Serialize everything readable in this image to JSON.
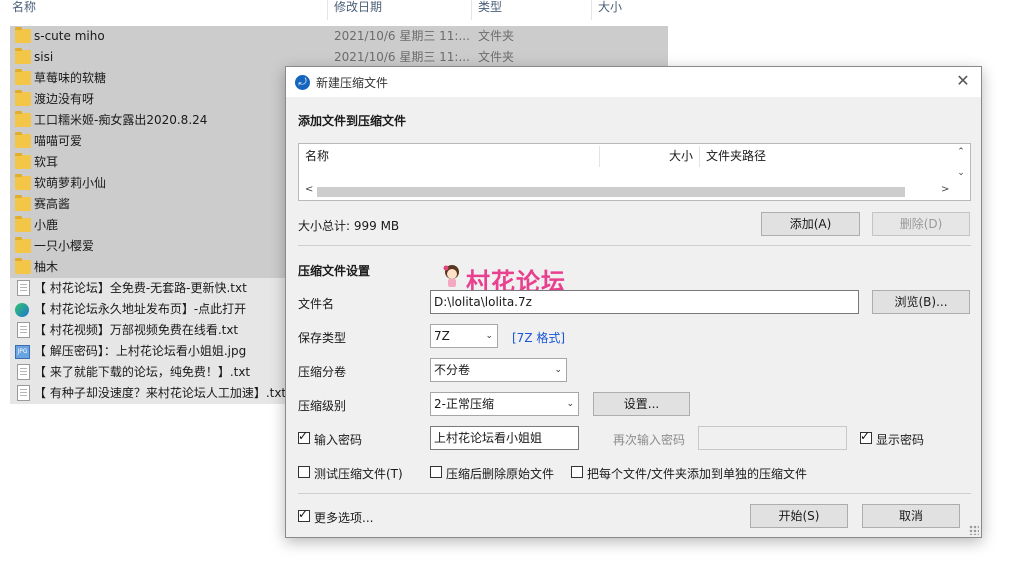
{
  "explorer": {
    "columns": {
      "name": "名称",
      "date": "修改日期",
      "type": "类型",
      "size": "大小"
    },
    "rows": [
      {
        "name": "s-cute miho",
        "date": "2021/10/6 星期三 11:...",
        "type": "文件夹",
        "icon": "folder-icon"
      },
      {
        "name": "sisi",
        "date": "2021/10/6 星期三 11:...",
        "type": "文件夹",
        "icon": "folder-icon"
      },
      {
        "name": "草莓味的软糖",
        "icon": "folder-icon"
      },
      {
        "name": "渡边没有呀",
        "icon": "folder-icon"
      },
      {
        "name": "工口糯米姬-痴女露出2020.8.24",
        "icon": "folder-icon"
      },
      {
        "name": "喵喵可爱",
        "icon": "folder-icon"
      },
      {
        "name": "软耳",
        "icon": "folder-icon"
      },
      {
        "name": "软萌萝莉小仙",
        "icon": "folder-icon"
      },
      {
        "name": "赛高酱",
        "icon": "folder-icon"
      },
      {
        "name": "小鹿",
        "icon": "folder-icon"
      },
      {
        "name": "一只小樱爱",
        "icon": "folder-icon"
      },
      {
        "name": "柚木",
        "icon": "folder-icon"
      },
      {
        "name": "【 村花论坛】全免费-无套路-更新快.txt",
        "icon": "text-file-icon"
      },
      {
        "name": "【 村花论坛永久地址发布页】-点此打开",
        "icon": "edge-browser-icon"
      },
      {
        "name": "【 村花视频】万部视频免费在线看.txt",
        "icon": "text-file-icon"
      },
      {
        "name": "【 解压密码】：上村花论坛看小姐姐.jpg",
        "icon": "image-file-icon"
      },
      {
        "name": "【 来了就能下载的论坛，纯免费！】.txt",
        "icon": "text-file-icon"
      },
      {
        "name": "【 有种子却没速度？来村花论坛人工加速】.txt",
        "icon": "text-file-icon"
      }
    ]
  },
  "dialog": {
    "title": "新建压缩文件",
    "add_section_title": "添加文件到压缩文件",
    "list_headers": {
      "name": "名称",
      "size": "大小",
      "path": "文件夹路径"
    },
    "total_size": "大小总计: 999 MB",
    "add_button": "添加(A)",
    "delete_button": "删除(D)",
    "settings_title": "压缩文件设置",
    "filename_label": "文件名",
    "filename_value": "D:\\lolita\\lolita.7z",
    "browse_button": "浏览(B)...",
    "save_type_label": "保存类型",
    "save_type_value": "7Z",
    "format_link": "[7Z 格式]",
    "split_label": "压缩分卷",
    "split_value": "不分卷",
    "level_label": "压缩级别",
    "level_value": "2-正常压缩",
    "settings_button": "设置...",
    "password_checkbox": {
      "label": "输入密码",
      "checked": true
    },
    "password_value": "上村花论坛看小姐姐",
    "reenter_label": "再次输入密码",
    "show_password": {
      "label": "显示密码",
      "checked": true
    },
    "test_archive": {
      "label": "测试压缩文件(T)",
      "checked": false
    },
    "delete_after": {
      "label": "压缩后删除原始文件",
      "checked": false
    },
    "separate_archives": {
      "label": "把每个文件/文件夹添加到单独的压缩文件",
      "checked": false
    },
    "more_options": {
      "label": "更多选项...",
      "checked": true
    },
    "start_button": "开始(S)",
    "cancel_button": "取消"
  },
  "watermark": {
    "text": "村花论坛"
  },
  "colors": {
    "accent_link": "#1a55d6",
    "watermark_pink": "#e83f8f",
    "folder_yellow": "#f3c647",
    "selection_grey": "#cccccc"
  }
}
